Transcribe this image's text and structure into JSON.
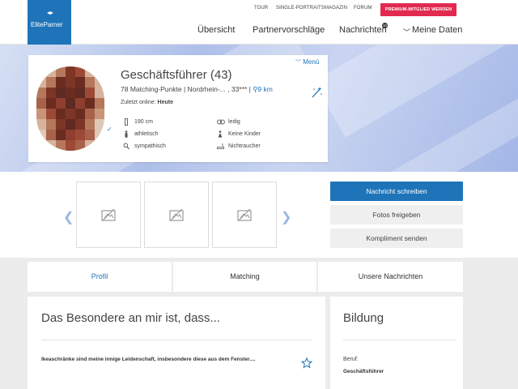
{
  "brand": {
    "logo_text": "EliteParner"
  },
  "top_links": [
    "TOUR",
    "SINGLE-PORTRAITS",
    "MAGAZIN",
    "FORUM"
  ],
  "premium_button": "PREMIUM-MITGLIED WERDEN",
  "main_nav": {
    "overview": "Übersicht",
    "suggestions": "Partnervorschläge",
    "messages": "Nachrichten",
    "messages_badge": "10",
    "my_data": "Meine Daten"
  },
  "profile": {
    "menu_label": "Menü",
    "name": "Geschäftsführer (43)",
    "points": "78 Matching-Punkte | Nordrhein-... , 33*** |",
    "distance": "9 km",
    "online_label": "Zuletzt online:",
    "online_value": "Heute",
    "attributes": {
      "height": "190 cm",
      "status": "ledig",
      "build": "athletisch",
      "children": "Keine Kinder",
      "appearance": "sympathisch",
      "smoking": "Nichtraucher"
    }
  },
  "actions": {
    "write_message": "Nachricht schreiben",
    "release_photos": "Fotos freigeben",
    "send_compliment": "Kompliment senden"
  },
  "tabs": [
    "Profil",
    "Matching",
    "Unsere Nachrichten"
  ],
  "special_section": {
    "title": "Das Besondere an mir ist, dass...",
    "text": "Ikeaschränke sind meine innige Leidenschaft, insbesondere diese aus dem Fenster...."
  },
  "education": {
    "title": "Bildung",
    "job_label": "Beruf:",
    "job_value": "Geschäftsführer"
  },
  "colors": {
    "brand_blue": "#1f74b9",
    "premium_red": "#e2294f"
  }
}
